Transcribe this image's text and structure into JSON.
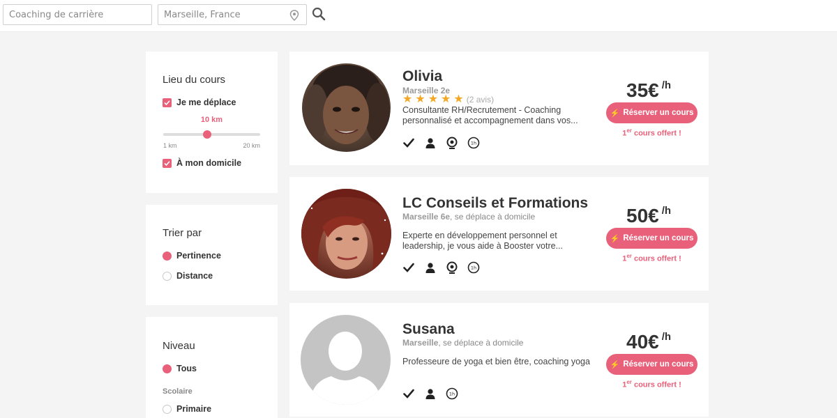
{
  "search": {
    "query_placeholder": "Coaching de carrière",
    "location_value": "Marseille, France"
  },
  "filters": {
    "lieu": {
      "title": "Lieu du cours",
      "je_me_deplace": "Je me déplace",
      "distance_value": "10 km",
      "distance_fraction": 0.45,
      "min_label": "1 km",
      "max_label": "20 km",
      "a_domicile": "À mon domicile"
    },
    "trier": {
      "title": "Trier par",
      "options": [
        "Pertinence",
        "Distance"
      ],
      "selected": "Pertinence"
    },
    "niveau": {
      "title": "Niveau",
      "tous": "Tous",
      "scolaire": "Scolaire",
      "primaire": "Primaire"
    }
  },
  "cards": [
    {
      "name": "Olivia",
      "city": "Marseille 2e",
      "travel": "",
      "rating": 5,
      "reviews": "(2 avis)",
      "description": "Consultante RH/Recrutement - Coaching personnalisé et accompagnement dans vos...",
      "price": "35€",
      "unit": "/h",
      "book_label": "Réserver un cours",
      "offer_sup": "er",
      "offer_pre": "1",
      "offer_post": " cours offert !"
    },
    {
      "name": "LC Conseils et Formations",
      "city": "Marseille 6e",
      "travel": ", se déplace à domicile",
      "description": "Experte en développement personnel et leadership, je vous aide à Booster votre...",
      "price": "50€",
      "unit": "/h",
      "book_label": "Réserver un cours",
      "offer_sup": "er",
      "offer_pre": "1",
      "offer_post": " cours offert !"
    },
    {
      "name": "Susana",
      "city": "Marseille",
      "travel": ", se déplace à domicile",
      "description": "Professeure de yoga et bien être, coaching yoga",
      "price": "40€",
      "unit": "/h",
      "book_label": "Réserver un cours",
      "offer_sup": "er",
      "offer_pre": "1",
      "offer_post": " cours offert !"
    }
  ],
  "icons": [
    "checkmark-icon",
    "person-icon",
    "webcam-icon",
    "one-hour-icon"
  ],
  "colors": {
    "accent": "#e8607a",
    "star": "#f3a724",
    "page_bg": "#f4f4f4"
  }
}
